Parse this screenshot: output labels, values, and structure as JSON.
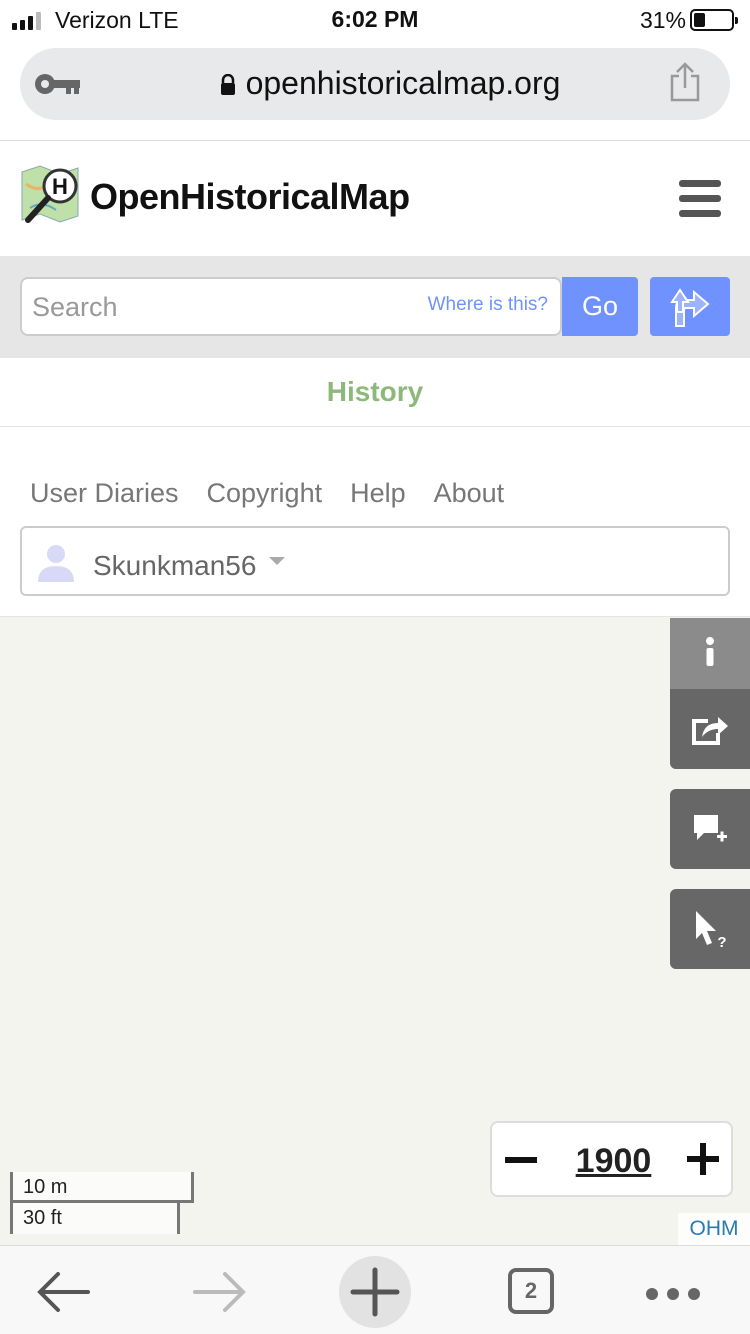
{
  "status_bar": {
    "carrier": "Verizon  LTE",
    "time": "6:02 PM",
    "battery_percent": "31%",
    "battery_level": 0.31
  },
  "browser": {
    "url": "openhistoricalmap.org",
    "key_icon": "key-icon",
    "lock_icon": "lock-icon",
    "share_icon": "share-icon"
  },
  "header": {
    "brand": "OpenHistoricalMap",
    "logo_icon": "ohm-logo-icon",
    "menu_icon": "hamburger-icon"
  },
  "search": {
    "placeholder": "Search",
    "where_link": "Where is this?",
    "go_label": "Go",
    "directions_icon": "directions-icon",
    "accent": "#7092ff"
  },
  "history": {
    "label": "History",
    "color": "#8cb97a"
  },
  "nav": {
    "links": [
      "User Diaries",
      "Copyright",
      "Help",
      "About"
    ]
  },
  "user": {
    "username": "Skunkman56",
    "avatar_icon": "user-avatar-icon"
  },
  "map": {
    "controls": [
      "info-icon",
      "share-map-icon",
      "add-note-icon",
      "query-features-icon"
    ],
    "timeslider": {
      "year": "1900",
      "minus_icon": "minus-icon",
      "plus_icon": "plus-icon"
    },
    "scale": {
      "metric": "10 m",
      "imperial": "30 ft"
    },
    "attribution": "OHM"
  },
  "toolbar": {
    "tab_count": "2",
    "icons": [
      "back-arrow-icon",
      "forward-arrow-icon",
      "new-tab-icon",
      "tabs-icon",
      "more-icon"
    ]
  }
}
